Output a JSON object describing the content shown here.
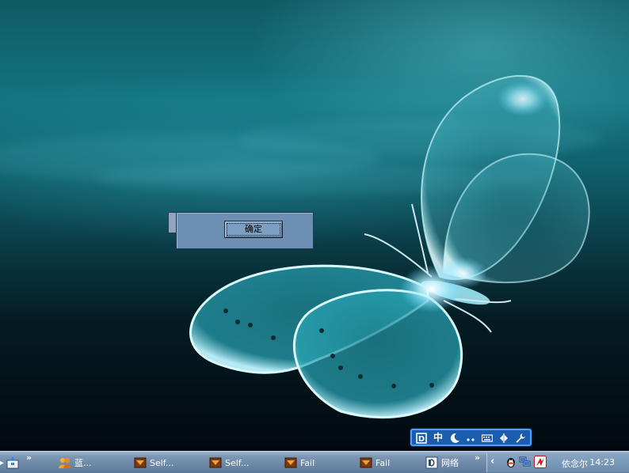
{
  "dialog": {
    "ok_label": "确定"
  },
  "ime_bar": {
    "items": [
      "ime-logo-icon",
      "中",
      "moon-icon",
      "punct-icon",
      "keyboard-icon",
      "softkey-icon",
      "wrench-icon"
    ],
    "mode_label": "中"
  },
  "taskbar": {
    "overflow_chevron": "»",
    "tasks": [
      {
        "label": "蓝...",
        "icon": "people-icon"
      },
      {
        "label": "Self...",
        "icon": "app-icon"
      },
      {
        "label": "Self...",
        "icon": "app-icon"
      },
      {
        "label": "Fail",
        "icon": "app-icon"
      },
      {
        "label": "Fail",
        "icon": "app-icon"
      },
      {
        "label": "网络",
        "icon": "network-doc-icon"
      }
    ],
    "tray": {
      "expand": "‹",
      "user_label": "依念尔",
      "time": "14:23"
    }
  }
}
